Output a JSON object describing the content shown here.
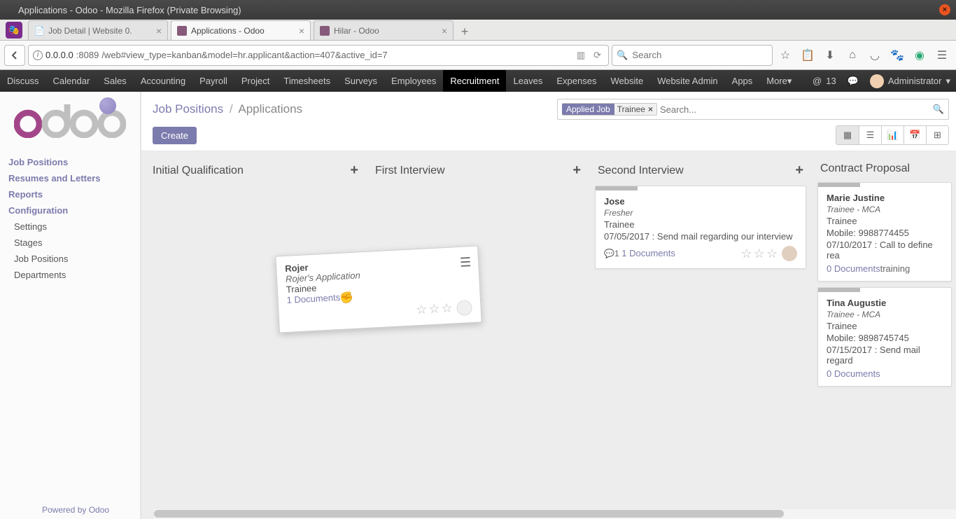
{
  "os": {
    "title": "Applications - Odoo - Mozilla Firefox (Private Browsing)"
  },
  "browser": {
    "tabs": [
      {
        "title": "Job Detail | Website 0.",
        "active": false
      },
      {
        "title": "Applications - Odoo",
        "active": true
      },
      {
        "title": "Hilar - Odoo",
        "active": false
      }
    ],
    "url_host": "0.0.0.0",
    "url_port": ":8089",
    "url_path": "/web#view_type=kanban&model=hr.applicant&action=407&active_id=7",
    "search_placeholder": "Search"
  },
  "topmenu": {
    "items": [
      "Discuss",
      "Calendar",
      "Sales",
      "Accounting",
      "Payroll",
      "Project",
      "Timesheets",
      "Surveys",
      "Employees",
      "Recruitment",
      "Leaves",
      "Expenses",
      "Website",
      "Website Admin",
      "Apps",
      "More"
    ],
    "active": "Recruitment",
    "msgcount": "13",
    "user": "Administrator"
  },
  "sidebar": {
    "main": [
      "Job Positions",
      "Resumes and Letters",
      "Reports",
      "Configuration"
    ],
    "sub": [
      "Settings",
      "Stages",
      "Job Positions",
      "Departments"
    ],
    "powered_prefix": "Powered by ",
    "powered_brand": "Odoo"
  },
  "control": {
    "breadcrumb_root": "Job Positions",
    "breadcrumb_current": "Applications",
    "filter_label": "Applied Job",
    "filter_value": "Trainee",
    "search_placeholder": "Search...",
    "create": "Create"
  },
  "columns": {
    "c0": {
      "title": "Initial Qualification"
    },
    "c1": {
      "title": "First Interview"
    },
    "c2": {
      "title": "Second Interview"
    },
    "c3": {
      "title": "Contract Proposal"
    }
  },
  "dragcard": {
    "name": "Rojer",
    "subtitle": "Rojer's Application",
    "job": "Trainee",
    "docs": "1 Documents"
  },
  "cards": {
    "jose": {
      "name": "Jose",
      "subtitle": "Fresher",
      "job": "Trainee",
      "activity": "07/05/2017 : Send mail regarding our interview",
      "msgcount": "1",
      "docs": "1 Documents"
    },
    "marie": {
      "name": "Marie Justine",
      "subtitle": "Trainee - MCA",
      "job": "Trainee",
      "mobile": "Mobile: 9988774455",
      "activity": "07/10/2017 : Call to define rea",
      "docs": "0 Documents",
      "extra": "training"
    },
    "tina": {
      "name": "Tina Augustie",
      "subtitle": "Trainee - MCA",
      "job": "Trainee",
      "mobile": "Mobile: 9898745745",
      "activity": "07/15/2017 : Send mail regard",
      "docs": "0 Documents"
    }
  }
}
